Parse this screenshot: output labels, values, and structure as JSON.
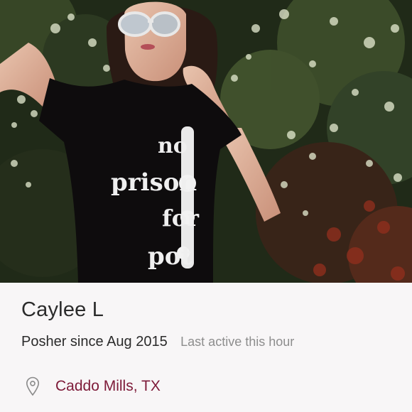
{
  "profile": {
    "cover_photo": {
      "description_icon": "profile-cover-photo",
      "shirt_text": [
        "no",
        "prison",
        "for",
        "pot"
      ]
    },
    "name": "Caylee L",
    "posher_since": "Posher since Aug 2015",
    "last_active": "Last active this hour",
    "location": "Caddo Mills, TX",
    "location_icon": "map-pin-icon"
  },
  "colors": {
    "location_text": "#7d1a38",
    "primary_text": "#2b2b2b",
    "secondary_text": "#8d8d8d",
    "panel_bg": "#f8f6f7"
  }
}
